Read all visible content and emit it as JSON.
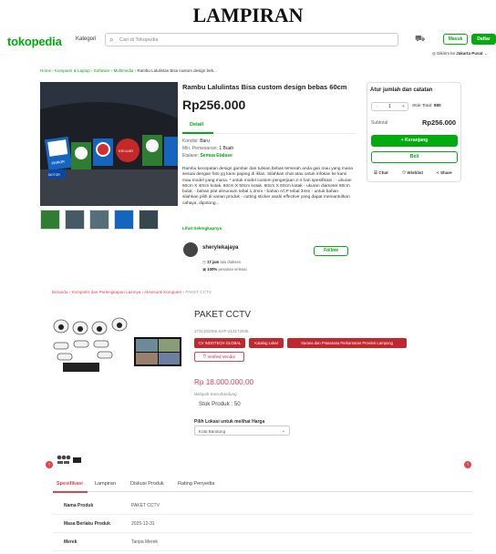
{
  "heading": "LAMPIRAN",
  "tokopedia": {
    "logo": "tokopedia",
    "kategori": "Kategori",
    "search_placeholder": "Cari di Tokopedia",
    "masuk": "Masuk",
    "daftar": "Daftar",
    "ship_prefix": "Dikirim ke",
    "ship_city": "Jakarta Pusat",
    "breadcrumb": [
      "Home",
      "Komputer & Laptop",
      "Software",
      "Multimedia"
    ],
    "breadcrumb_current": "Rambu Lalulintas Bisa custom design beb...",
    "product_title": "Rambu Lalulintas Bisa custom design bebas 60cm",
    "price": "Rp256.000",
    "detail_tab": "Detail",
    "kondisi_label": "Kondisi:",
    "kondisi": "Baru",
    "min_label": "Min. Pemesanan:",
    "min": "1 Buah",
    "etalase_label": "Etalase:",
    "etalase": "Semua Etalase",
    "description": "Rambu kecepatan design gambar dan tulisan bebas terserah anda gan mau yang mana sesuai dengan foto yg kami pajang di iklan. Silahkan chat atau untuk infokan ke kami mau model yang mana. * untuk model custom pengerjaan 2-4 hari spesifikasi : - ukuran 60cm X 40cm kotak. 60cm X 50cm kotak. 60cm X 60cm kotak - ukuran diameter 60cm bulat. - bahan plat almunium tebal 1,2mm - bahan ACP tebal 3mm - untuk bahan silahkan pilih di varian produk - cutting sticker asahi effective yang dapat memantulkan cahaya, dipotong...",
    "more": "Lihat Selengkapnya",
    "seller": "sherylekajaya",
    "follow": "Follow",
    "online": "17 jam",
    "online_suffix": "lalu diakses",
    "processed": "100%",
    "processed_suffix": "pesanan selesai",
    "cart_title": "Atur jumlah dan catatan",
    "qty": "1",
    "stock_label": "Stok Total:",
    "stock": "980",
    "subtotal_label": "Subtotal",
    "subtotal": "Rp256.000",
    "add_cart": "+ Keranjang",
    "buy": "Beli",
    "chat": "Chat",
    "wishlist": "Wishlist",
    "share": "Share",
    "sign_texts": [
      "PARKIR",
      "MOTOR",
      "KELUAR"
    ]
  },
  "eproc": {
    "breadcrumb": [
      "Beranda",
      "Komputer dan Perlengkapan Lainnya",
      "Aksesoris Komputer"
    ],
    "breadcrumb_current": "PAKET CCTV",
    "title": "PAKET CCTV",
    "sku": "4731302006-SAP-213172945",
    "tags": [
      "CV INDOTECH GLOBAL",
      "Katalog Lokal",
      "Sarana dan Prasarana Perkantoran Provinsi Lampung"
    ],
    "vendor": "Verified Vendor",
    "price": "Rp 18.000.000,00",
    "wilayah": "Wilayah Kota Bandung",
    "stock": "Stok Produk :  50",
    "lokasi_label": "Pilih Lokasi untuk melihat Harga",
    "lokasi_value": "Kota Bandung",
    "tabs": [
      "Spesifikasi",
      "Lampiran",
      "Diskusi Produk",
      "Rating Penyedia"
    ],
    "specs": [
      {
        "k": "Nama Produk",
        "v": "PAKET CCTV"
      },
      {
        "k": "Masa Berlaku Produk",
        "v": "2025-12-31"
      },
      {
        "k": "Merek",
        "v": "Tanpa Merek"
      }
    ]
  },
  "colors": {
    "tokopedia_green": "#03ac0e",
    "eproc_red": "#e0444f"
  }
}
